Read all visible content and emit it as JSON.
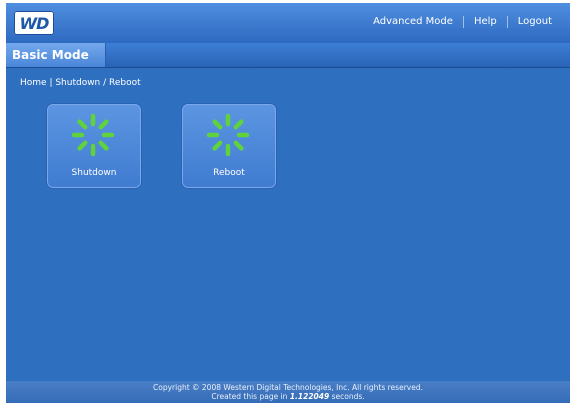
{
  "header": {
    "logo_text": "WD",
    "links": [
      {
        "label": "Advanced Mode"
      },
      {
        "label": "Help"
      },
      {
        "label": "Logout"
      }
    ]
  },
  "mode": {
    "label": "Basic Mode"
  },
  "breadcrumb": {
    "text": "Home | Shutdown / Reboot"
  },
  "actions": [
    {
      "label": "Shutdown",
      "icon": "power-spinner-icon"
    },
    {
      "label": "Reboot",
      "icon": "power-spinner-icon"
    }
  ],
  "footer": {
    "copyright": "Copyright © 2008 Western Digital Technologies, Inc. All rights reserved.",
    "created_prefix": "Created this page in",
    "created_time": "1.122049",
    "created_suffix": "seconds."
  },
  "colors": {
    "accent": "#2f6fc0",
    "icon": "#5fd23c"
  }
}
